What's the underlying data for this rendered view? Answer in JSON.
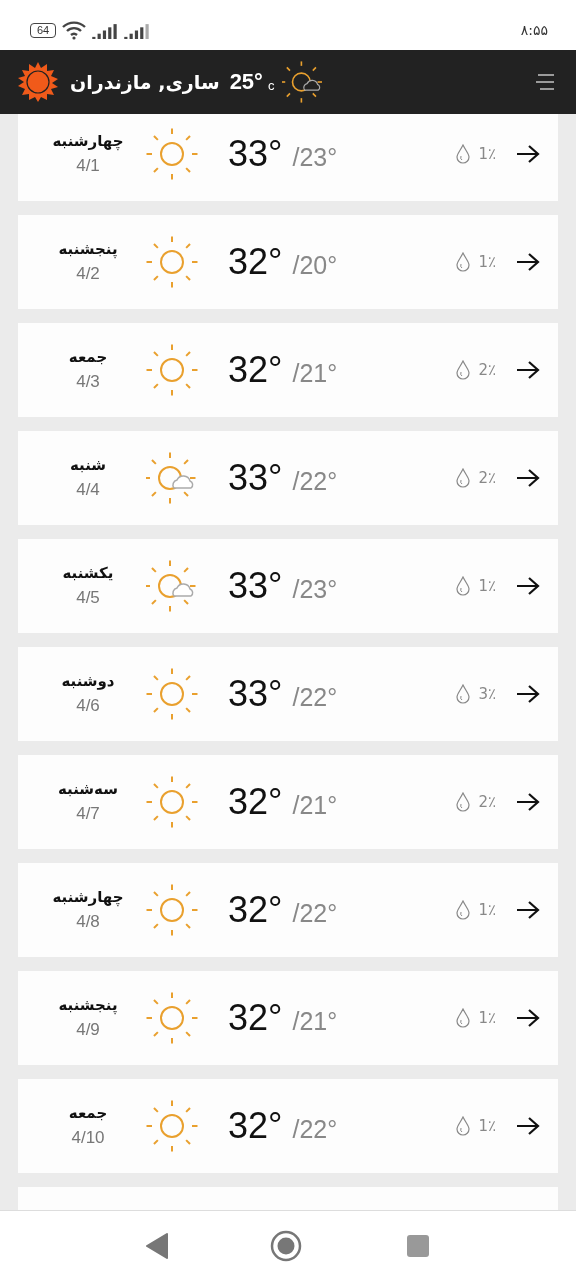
{
  "status_bar": {
    "battery": "64",
    "time": "۸:۵۵"
  },
  "header": {
    "location": "ساری, مازندران",
    "temperature": "25°",
    "unit": "c",
    "kind": "partly-cloudy"
  },
  "days": [
    {
      "day": "چهارشنبه",
      "date": "4/1",
      "kind": "sunny",
      "high": "33°",
      "low": "/23°",
      "precipitation": "1٪"
    },
    {
      "day": "پنجشنبه",
      "date": "4/2",
      "kind": "sunny",
      "high": "32°",
      "low": "/20°",
      "precipitation": "1٪"
    },
    {
      "day": "جمعه",
      "date": "4/3",
      "kind": "sunny",
      "high": "32°",
      "low": "/21°",
      "precipitation": "2٪"
    },
    {
      "day": "شنبه",
      "date": "4/4",
      "kind": "partly-cloudy",
      "high": "33°",
      "low": "/22°",
      "precipitation": "2٪"
    },
    {
      "day": "یکشنبه",
      "date": "4/5",
      "kind": "partly-cloudy",
      "high": "33°",
      "low": "/23°",
      "precipitation": "1٪"
    },
    {
      "day": "دوشنبه",
      "date": "4/6",
      "kind": "sunny",
      "high": "33°",
      "low": "/22°",
      "precipitation": "3٪"
    },
    {
      "day": "سه‌شنبه",
      "date": "4/7",
      "kind": "sunny",
      "high": "32°",
      "low": "/21°",
      "precipitation": "2٪"
    },
    {
      "day": "چهارشنبه",
      "date": "4/8",
      "kind": "sunny",
      "high": "32°",
      "low": "/22°",
      "precipitation": "1٪"
    },
    {
      "day": "پنجشنبه",
      "date": "4/9",
      "kind": "sunny",
      "high": "32°",
      "low": "/21°",
      "precipitation": "1٪"
    },
    {
      "day": "جمعه",
      "date": "4/10",
      "kind": "sunny",
      "high": "32°",
      "low": "/22°",
      "precipitation": "1٪"
    }
  ]
}
